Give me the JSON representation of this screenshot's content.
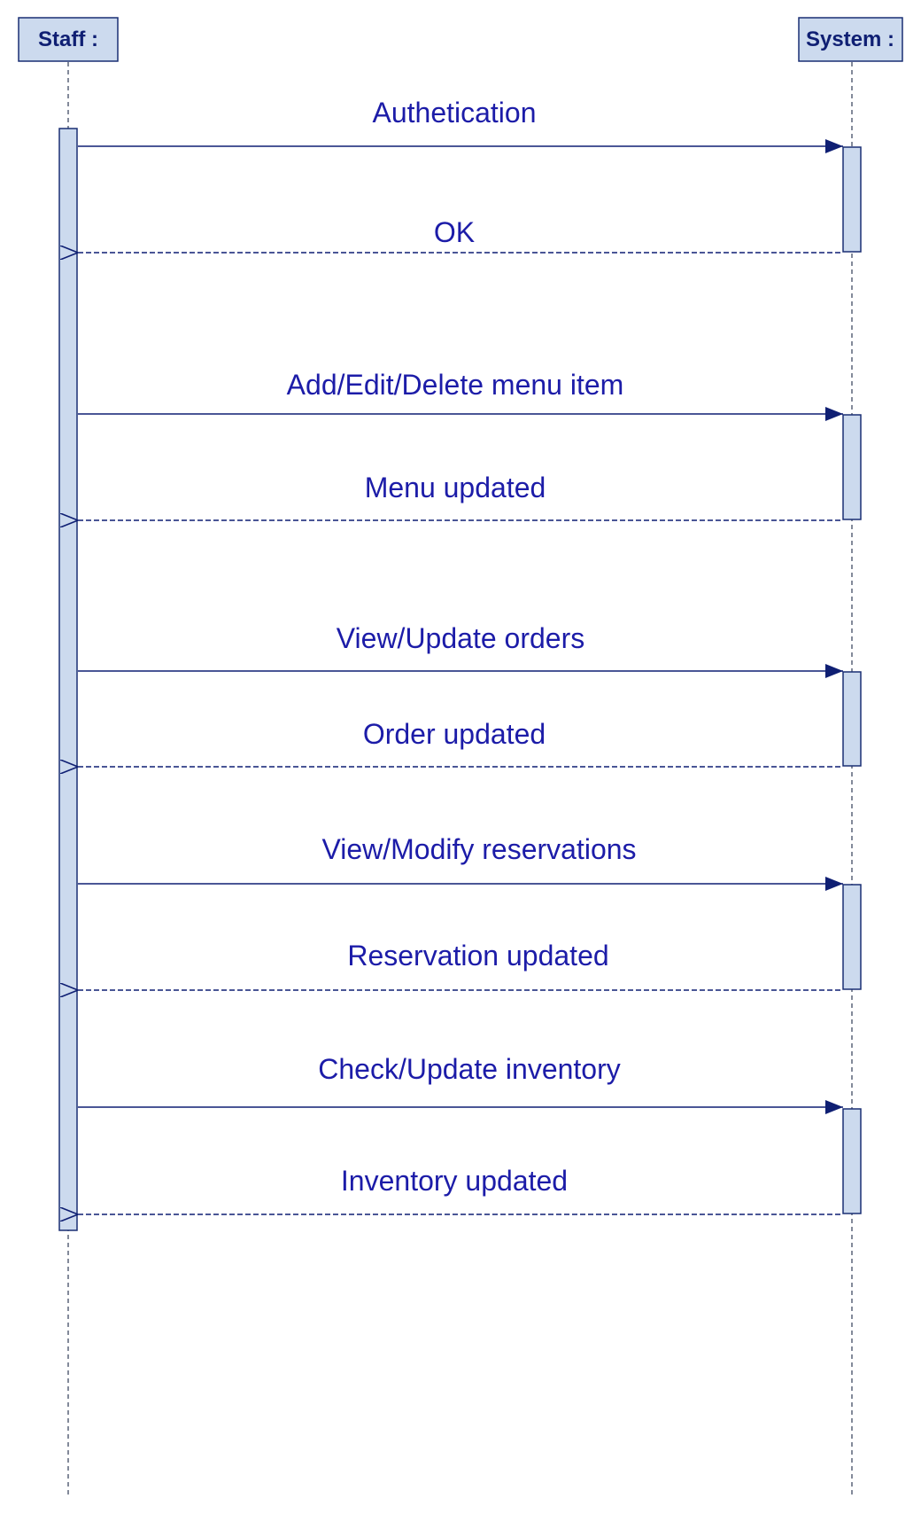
{
  "colors": {
    "ink": "#0f1f73",
    "text": "#1c1ca8",
    "box_fill": "#ccdaee",
    "box_stroke": "#1a2f74",
    "dash": "#5a6478"
  },
  "lifelines": [
    {
      "label": "Staff :"
    },
    {
      "label": "System :"
    }
  ],
  "messages": [
    {
      "label": "Authetication",
      "type": "call"
    },
    {
      "label": "OK",
      "type": "return"
    },
    {
      "label": "Add/Edit/Delete menu item",
      "type": "call"
    },
    {
      "label": "Menu updated",
      "type": "return"
    },
    {
      "label": "View/Update orders",
      "type": "call"
    },
    {
      "label": "Order updated",
      "type": "return"
    },
    {
      "label": "View/Modify reservations",
      "type": "call"
    },
    {
      "label": "Reservation updated",
      "type": "return"
    },
    {
      "label": "Check/Update inventory",
      "type": "call"
    },
    {
      "label": "Inventory updated",
      "type": "return"
    }
  ]
}
